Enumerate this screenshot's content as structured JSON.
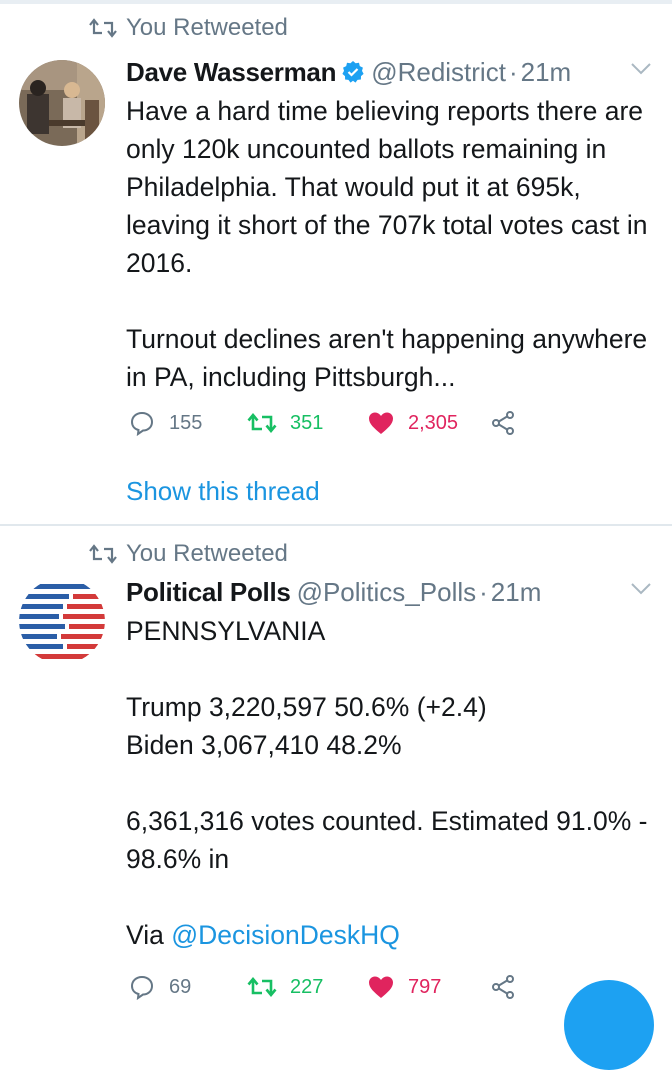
{
  "tweets": [
    {
      "retweet_label": "You Retweeted",
      "name": "Dave Wasserman",
      "verified": true,
      "handle": "@Redistrict",
      "separator": "·",
      "time": "21m",
      "body": "Have a hard time believing reports there are only 120k uncounted ballots remaining in Philadelphia. That would put it at 695k, leaving it short of the 707k total votes cast in 2016.\n\nTurnout declines aren't happening anywhere in PA, including Pittsburgh...",
      "replies": "155",
      "retweets": "351",
      "likes": "2,305",
      "show_thread": "Show this thread"
    },
    {
      "retweet_label": "You Retweeted",
      "name": "Political Polls",
      "verified": false,
      "handle": "@Politics_Polls",
      "separator": "·",
      "time": "21m",
      "body": "PENNSYLVANIA\n\nTrump 3,220,597 50.6% (+2.4)\nBiden 3,067,410 48.2%\n\n6,361,316 votes counted. Estimated 91.0% - 98.6% in\n\nVia ",
      "mention": "@DecisionDeskHQ",
      "replies": "69",
      "retweets": "227",
      "likes": "797"
    }
  ],
  "colors": {
    "link_blue": "#1b95e0",
    "retweet_green": "#17bf63",
    "like_red": "#e0245e",
    "muted_gray": "#657786"
  },
  "icons": [
    "retweet-icon",
    "verified-badge-icon",
    "chevron-down-icon",
    "reply-icon",
    "like-heart-icon",
    "share-icon"
  ]
}
